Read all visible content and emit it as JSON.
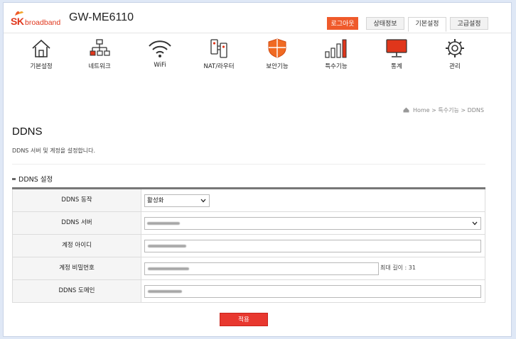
{
  "brand": {
    "sk": "SK",
    "broadband": "broadband"
  },
  "model": "GW-ME6110",
  "top_tabs": {
    "logout": "로그아웃",
    "status": "상태정보",
    "basic": "기본설정",
    "advanced": "고급설정"
  },
  "nav": [
    {
      "label": "기본설정",
      "icon": "house-icon"
    },
    {
      "label": "네트워크",
      "icon": "network-icon"
    },
    {
      "label": "WiFi",
      "icon": "wifi-icon"
    },
    {
      "label": "NAT/라우터",
      "icon": "router-icon"
    },
    {
      "label": "보안기능",
      "icon": "shield-icon"
    },
    {
      "label": "특수기능",
      "icon": "bar-chart-icon"
    },
    {
      "label": "통계",
      "icon": "monitor-icon"
    },
    {
      "label": "관리",
      "icon": "gear-icon"
    }
  ],
  "breadcrumb": {
    "home": "Home",
    "sep1": ">",
    "mid": "특수기능",
    "sep2": ">",
    "current": "DDNS"
  },
  "page": {
    "title": "DDNS",
    "description": "DDNS 서버 및 계정을 설정합니다."
  },
  "section": {
    "title": "DDNS 설정"
  },
  "form": {
    "ddns_action": {
      "label": "DDNS 동작",
      "value": "활성화"
    },
    "ddns_server": {
      "label": "DDNS 서버"
    },
    "account_id": {
      "label": "계정 아이디"
    },
    "account_password": {
      "label": "계정 비밀번호",
      "hint": "최대 길이 : 31"
    },
    "ddns_domain": {
      "label": "DDNS 도메인"
    }
  },
  "apply_button": "적용",
  "colors": {
    "accent": "#e0361b",
    "logout": "#ef5a2b",
    "apply": "#e8382f",
    "shield": "#f06a22"
  }
}
